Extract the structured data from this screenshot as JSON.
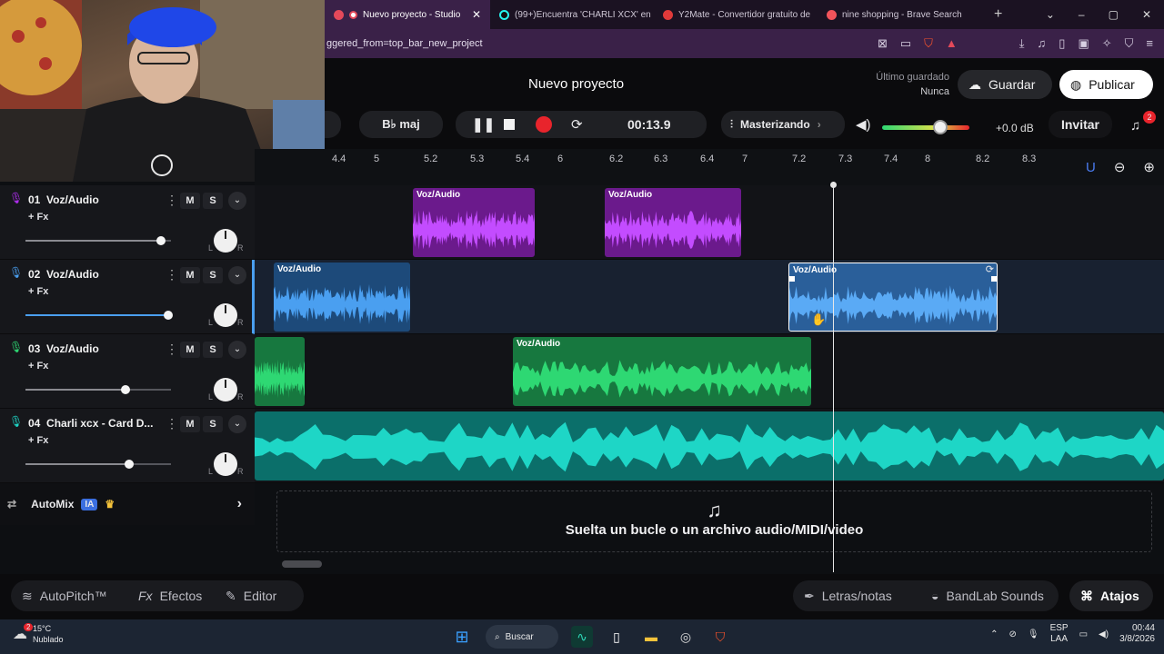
{
  "browser": {
    "tabs": [
      {
        "title": "Nuevo proyecto - Studio",
        "active": true,
        "color": "#e4495a"
      },
      {
        "title": "(99+)Encuentra 'CHARLI XCX' en",
        "active": false,
        "color": "#ffffff"
      },
      {
        "title": "Y2Mate - Convertidor gratuito de",
        "active": false,
        "color": "#e03a3a"
      },
      {
        "title": "nine shopping - Brave Search",
        "active": false,
        "color": "#f2545b"
      }
    ],
    "new_tab": "+",
    "url_text": "ggered_from=top_bar_new_project",
    "win_controls": [
      "⌄",
      "–",
      "▢",
      "✕"
    ]
  },
  "studio": {
    "project_title": "Nuevo proyecto",
    "last_saved_label": "Último guardado",
    "last_saved_value": "Nunca",
    "save_label": "Guardar",
    "publish_label": "Publicar",
    "key_label": "B♭ maj",
    "time": "00:13.9",
    "mastering_label": "Masterizando",
    "volume_db": "+0.0 dB",
    "master_volume_level": 0.67,
    "invite_label": "Invitar",
    "notif_count": "2",
    "accent": "#f5c33b"
  },
  "timeline": {
    "ticks": [
      "4.4",
      "5",
      "5.2",
      "5.3",
      "5.4",
      "6",
      "6.2",
      "6.3",
      "6.4",
      "7",
      "7.2",
      "7.3",
      "7.4",
      "8",
      "8.2",
      "8.3"
    ]
  },
  "tracks": [
    {
      "num": "01",
      "name": "Voz/Audio",
      "fx": "+ Fx",
      "m": "M",
      "s": "S",
      "vol": 0.93,
      "color": "#b02ef0"
    },
    {
      "num": "02",
      "name": "Voz/Audio",
      "fx": "+ Fx",
      "m": "M",
      "s": "S",
      "vol": 0.98,
      "color": "#4a9ff0"
    },
    {
      "num": "03",
      "name": "Voz/Audio",
      "fx": "+ Fx",
      "m": "M",
      "s": "S",
      "vol": 0.69,
      "color": "#2ed873"
    },
    {
      "num": "04",
      "name": "Charli xcx - Card D...",
      "fx": "+ Fx",
      "m": "M",
      "s": "S",
      "vol": 0.71,
      "color": "#1ed6c6"
    }
  ],
  "clip_label": "Voz/Audio",
  "knob_l": "L",
  "knob_r": "R",
  "automix": {
    "label": "AutoMix",
    "badge": "IA"
  },
  "dropzone": {
    "text": "Suelta un bucle o un archivo audio/MIDI/video"
  },
  "bottom": {
    "autopitch": "AutoPitch™",
    "effects": "Efectos",
    "editor": "Editor",
    "lyrics": "Letras/notas",
    "sounds": "BandLab Sounds",
    "shortcuts": "Atajos"
  },
  "taskbar": {
    "weather_temp": "15°C",
    "weather_desc": "Nublado",
    "weather_badge": "2",
    "search": "Buscar",
    "lang1": "ESP",
    "lang2": "LAA",
    "time": "00:44",
    "date": "3/8/2026"
  }
}
